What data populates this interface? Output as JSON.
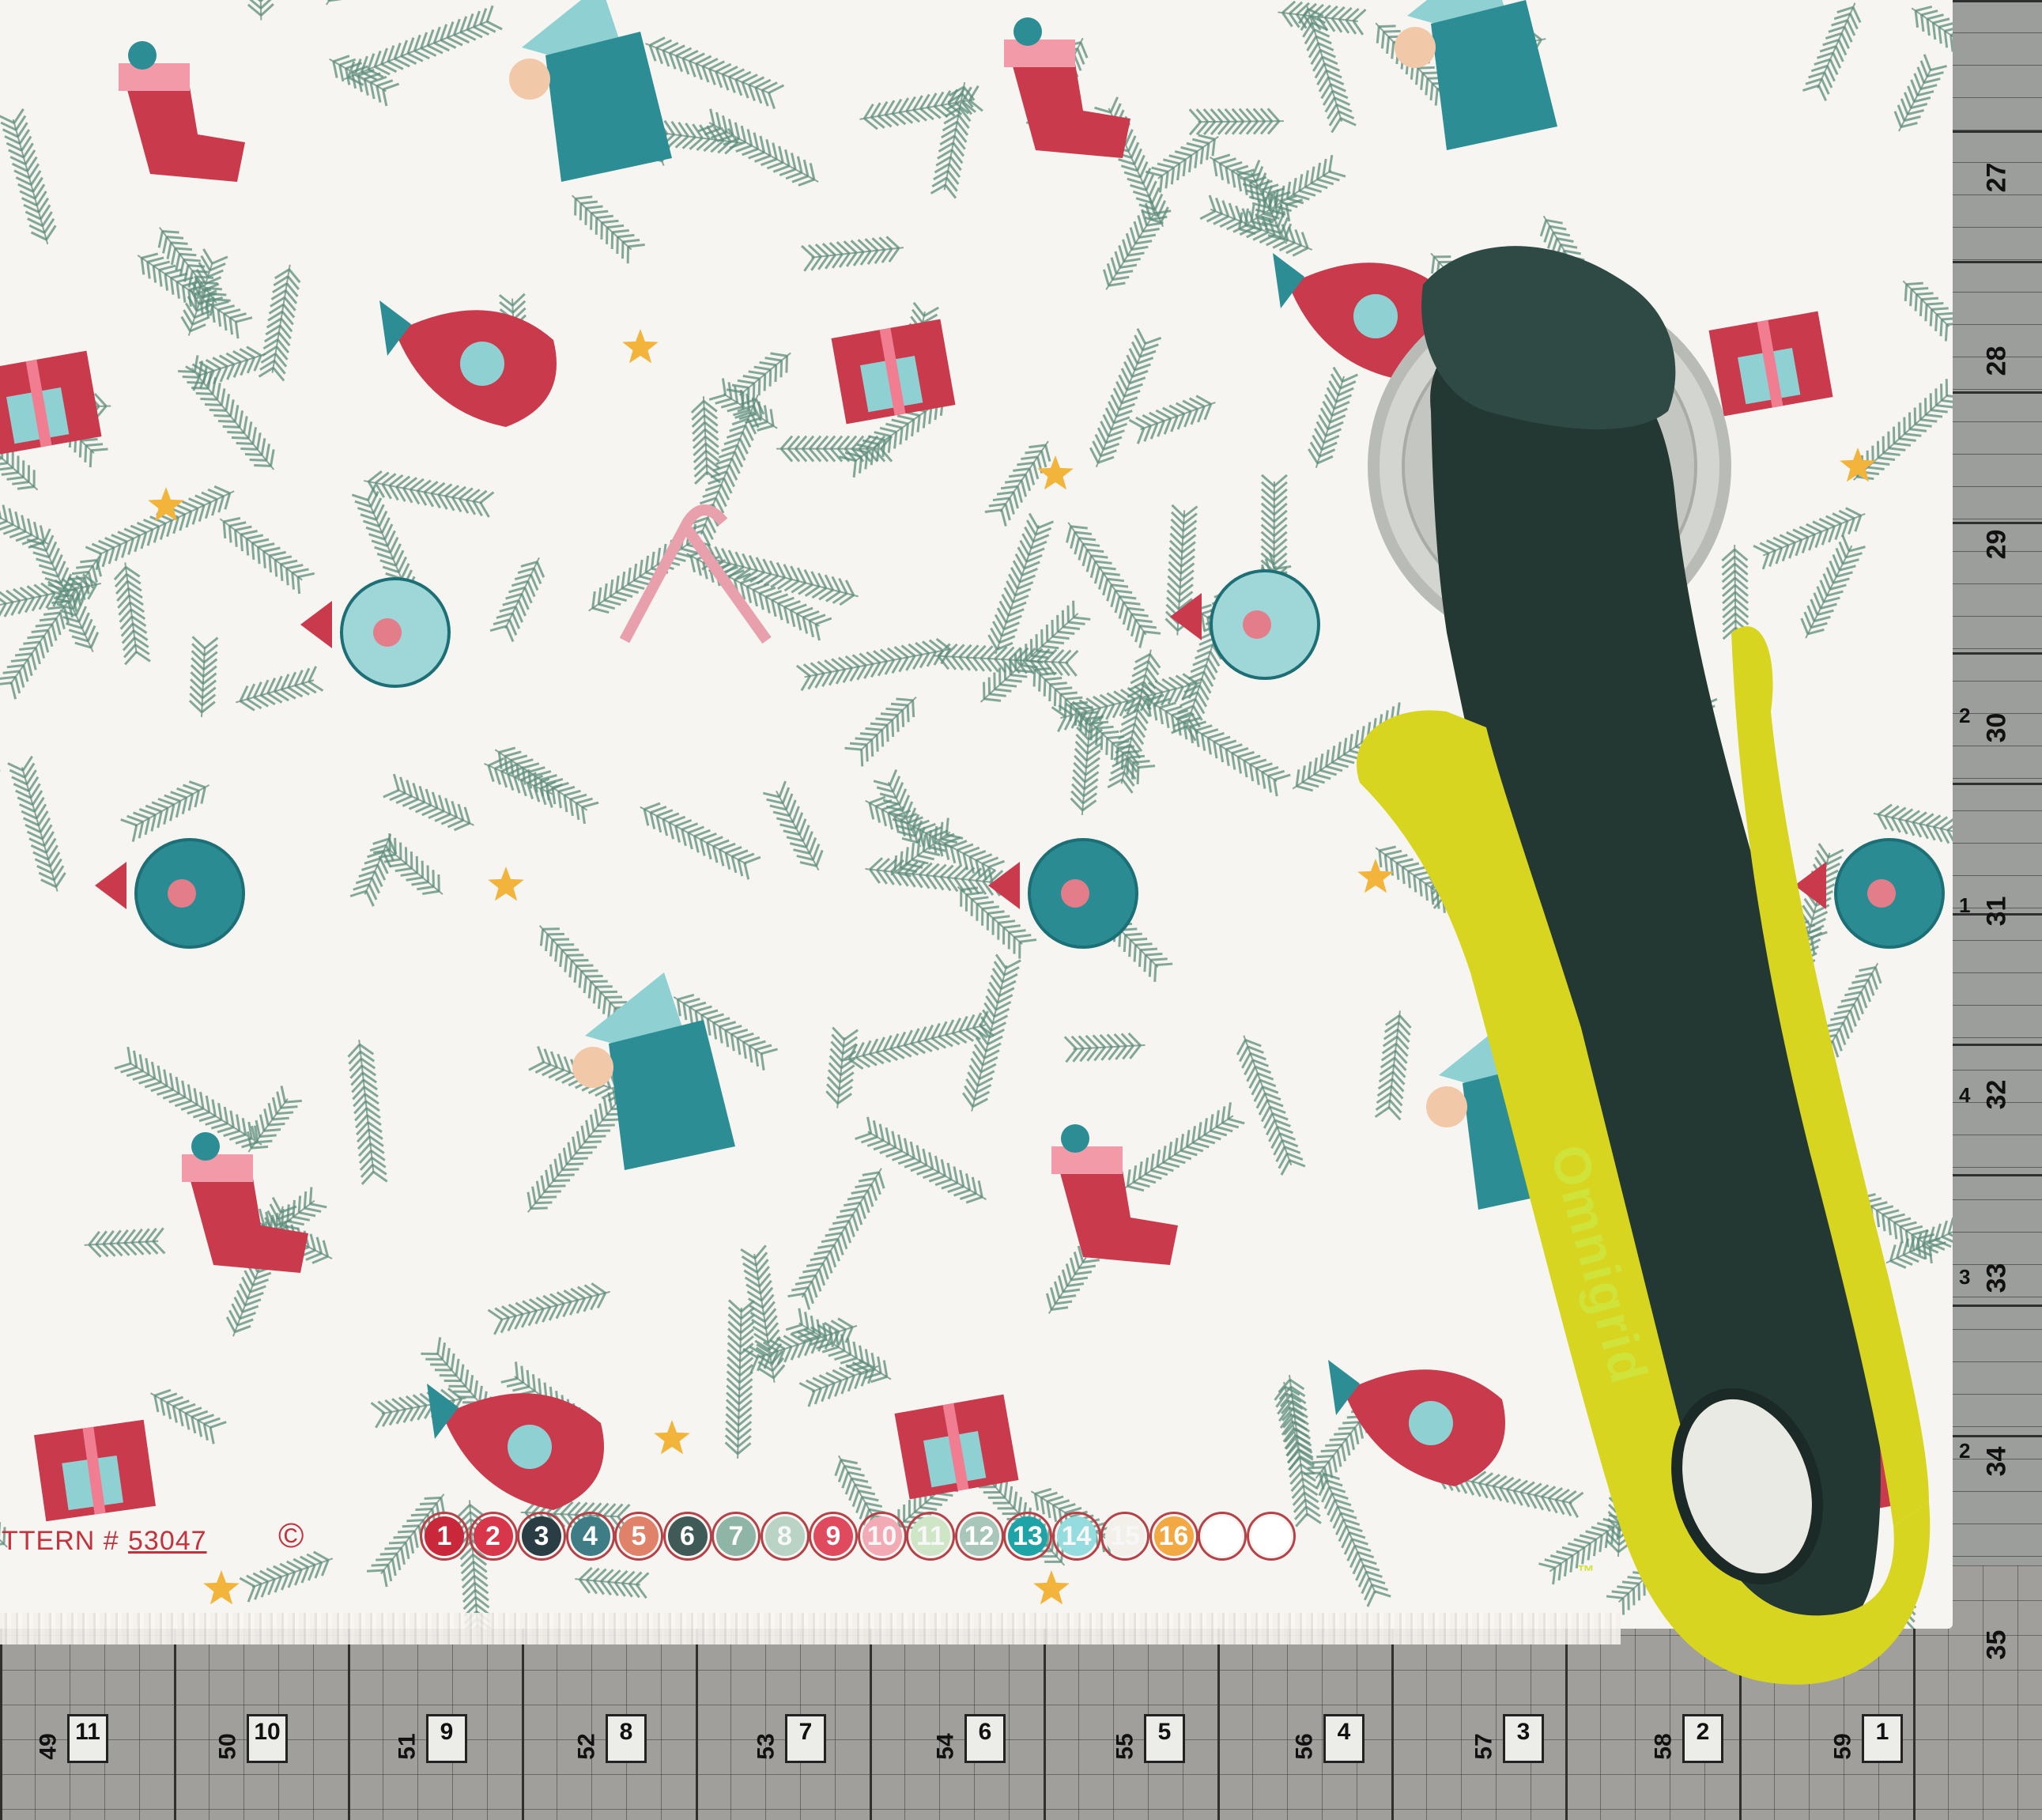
{
  "image": {
    "description_free": true
  },
  "mat": {
    "right_numbers": [
      "27",
      "28",
      "29",
      "30",
      "31",
      "32",
      "33",
      "34",
      "35"
    ],
    "right_small_numbers": [
      "2",
      "3",
      "4",
      "1",
      "2"
    ],
    "bottom_numbers": [
      "49",
      "50",
      "51",
      "52",
      "53",
      "54",
      "55",
      "56",
      "57",
      "58",
      "59"
    ],
    "bottom_box_numbers": [
      "11",
      "10",
      "9",
      "8",
      "7",
      "6",
      "5",
      "4",
      "3",
      "2",
      "1"
    ]
  },
  "selvage": {
    "pattern_label": "TTERN #",
    "pattern_number": "53047",
    "copyright": "©",
    "color_dots": [
      {
        "label": "1",
        "color": "#c8283a"
      },
      {
        "label": "2",
        "color": "#d8364a"
      },
      {
        "label": "3",
        "color": "#2b3d44"
      },
      {
        "label": "4",
        "color": "#3f7d86"
      },
      {
        "label": "5",
        "color": "#e0826a"
      },
      {
        "label": "6",
        "color": "#3f5a57"
      },
      {
        "label": "7",
        "color": "#8fb5a6"
      },
      {
        "label": "8",
        "color": "#b9d3c5"
      },
      {
        "label": "9",
        "color": "#e04a5e"
      },
      {
        "label": "10",
        "color": "#f2aab5"
      },
      {
        "label": "11",
        "color": "#cfe6c6"
      },
      {
        "label": "12",
        "color": "#a9c6bb"
      },
      {
        "label": "13",
        "color": "#1ea3a6"
      },
      {
        "label": "14",
        "color": "#94dcde"
      },
      {
        "label": "15",
        "color": "#f3f0ea"
      },
      {
        "label": "16",
        "color": "#f2a843"
      },
      {
        "label": "",
        "color": "#ffffff"
      },
      {
        "label": "",
        "color": "#ffffff"
      }
    ]
  },
  "cutter": {
    "brand": "Omnigrid",
    "trademark": "™"
  },
  "colors": {
    "fabric": "#f7f5f1",
    "pine": "#5c8d7c",
    "red": "#c93a4c",
    "teal": "#2c8e94",
    "aqua": "#8fd0d3",
    "gold": "#f2b43a",
    "pink": "#e98aa0",
    "cutter_yellow": "#d8d521",
    "cutter_green": "#233833",
    "blade": "#c9cbc6"
  }
}
